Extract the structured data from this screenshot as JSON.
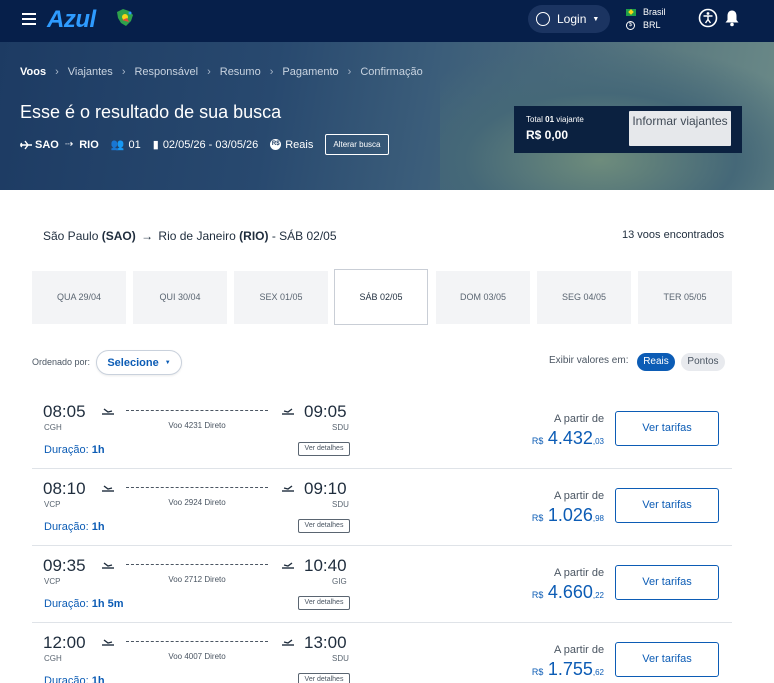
{
  "topnav": {
    "logo": "Azul",
    "login_label": "Login",
    "country": "Brasil",
    "currency": "BRL"
  },
  "breadcrumb": [
    "Voos",
    "Viajantes",
    "Responsável",
    "Resumo",
    "Pagamento",
    "Confirmação"
  ],
  "hero": {
    "title": "Esse é o resultado de sua busca",
    "origin": "SAO",
    "destination": "RIO",
    "passengers": "01",
    "dates": "02/05/26 - 03/05/26",
    "currency_mode": "Reais",
    "alter_label": "Alterar busca"
  },
  "total": {
    "label_prefix": "Total",
    "label_count": "01",
    "label_suffix": "viajante",
    "value": "R$ 0,00",
    "informar_label": "Informar viajantes"
  },
  "route": {
    "origin_city": "São Paulo",
    "origin_code": "(SAO)",
    "dest_city": "Rio de Janeiro",
    "dest_code": "(RIO)",
    "date": "- SÁB 02/05",
    "found": "13 voos encontrados"
  },
  "date_tabs": [
    {
      "label": "QUA 29/04",
      "selected": false
    },
    {
      "label": "QUI 30/04",
      "selected": false
    },
    {
      "label": "SEX 01/05",
      "selected": false
    },
    {
      "label": "SÁB 02/05",
      "selected": true
    },
    {
      "label": "DOM 03/05",
      "selected": false
    },
    {
      "label": "SEG 04/05",
      "selected": false
    },
    {
      "label": "TER 05/05",
      "selected": false
    }
  ],
  "controls": {
    "sort_label": "Ordenado por:",
    "sort_value": "Selecione",
    "show_label": "Exibir valores em:",
    "opt_reais": "Reais",
    "opt_pontos": "Pontos"
  },
  "flights": [
    {
      "dep_time": "08:05",
      "dep_code": "CGH",
      "arr_time": "09:05",
      "arr_code": "SDU",
      "voo": "Voo 4231 Direto",
      "dur_label": "Duração:",
      "dur": "1h",
      "details": "Ver detalhes",
      "from_label": "A partir de",
      "cur": "R$",
      "price_int": "4.432",
      "price_dec": ",03",
      "btn": "Ver tarifas"
    },
    {
      "dep_time": "08:10",
      "dep_code": "VCP",
      "arr_time": "09:10",
      "arr_code": "SDU",
      "voo": "Voo 2924 Direto",
      "dur_label": "Duração:",
      "dur": "1h",
      "details": "Ver detalhes",
      "from_label": "A partir de",
      "cur": "R$",
      "price_int": "1.026",
      "price_dec": ",98",
      "btn": "Ver tarifas"
    },
    {
      "dep_time": "09:35",
      "dep_code": "VCP",
      "arr_time": "10:40",
      "arr_code": "GIG",
      "voo": "Voo 2712 Direto",
      "dur_label": "Duração:",
      "dur": "1h 5m",
      "details": "Ver detalhes",
      "from_label": "A partir de",
      "cur": "R$",
      "price_int": "4.660",
      "price_dec": ",22",
      "btn": "Ver tarifas"
    },
    {
      "dep_time": "12:00",
      "dep_code": "CGH",
      "arr_time": "13:00",
      "arr_code": "SDU",
      "voo": "Voo 4007 Direto",
      "dur_label": "Duração:",
      "dur": "1h",
      "details": "Ver detalhes",
      "from_label": "A partir de",
      "cur": "R$",
      "price_int": "1.755",
      "price_dec": ",62",
      "btn": "Ver tarifas"
    }
  ],
  "colors": {
    "navy": "#061f4a",
    "brand_blue": "#0c5cb5",
    "logo_blue": "#2e9bff"
  }
}
